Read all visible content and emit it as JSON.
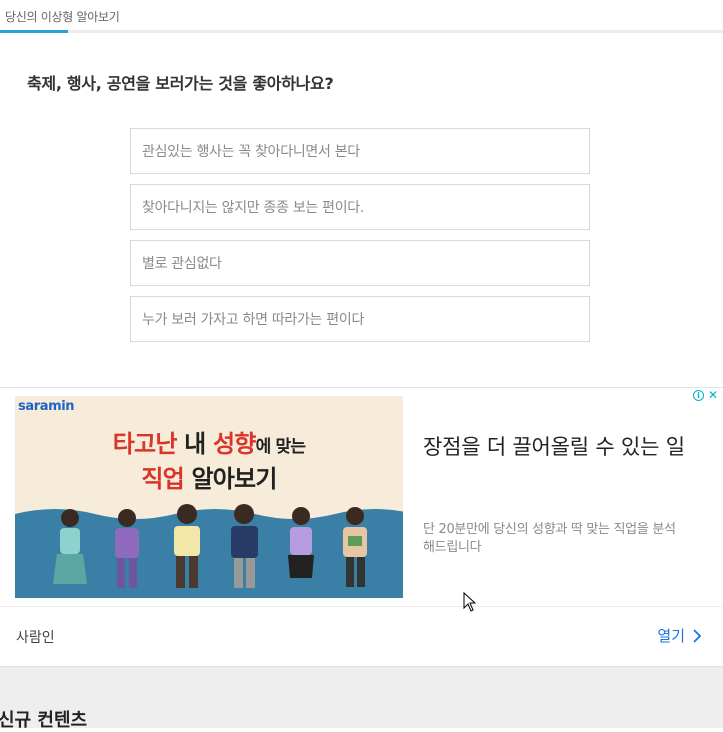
{
  "tabs": {
    "active_label": "당신의 이상형 알아보기"
  },
  "question": "축제, 행사, 공연을 보러가는 것을 좋아하나요?",
  "options": [
    "관심있는 행사는 꼭 찾아다니면서 본다",
    "찾아다니지는 않지만 종종 보는 편이다.",
    "별로 관심없다",
    "누가 보러 가자고 하면 따라가는 편이다"
  ],
  "ad": {
    "logo": "saramin",
    "image_line1_red1": "타고난",
    "image_line1_mid": " 내 ",
    "image_line1_red2": "성향",
    "image_line1_small": "에 맞는",
    "image_line2_red": "직업",
    "image_line2_rest": " 알아보기",
    "headline": "장점을 더 끌어올릴 수 있는 일",
    "description": "단 20분만에 당신의 성향과 딱 맞는 직업을 분석해드립니다",
    "brand": "사람인",
    "open_label": "열기",
    "info_icon_glyph": "i",
    "close_icon_glyph": "✕",
    "chevron_glyph": "›",
    "accent_color": "#00aecd",
    "link_color": "#1a73e8"
  },
  "section": {
    "title": "신규 컨텐츠"
  }
}
